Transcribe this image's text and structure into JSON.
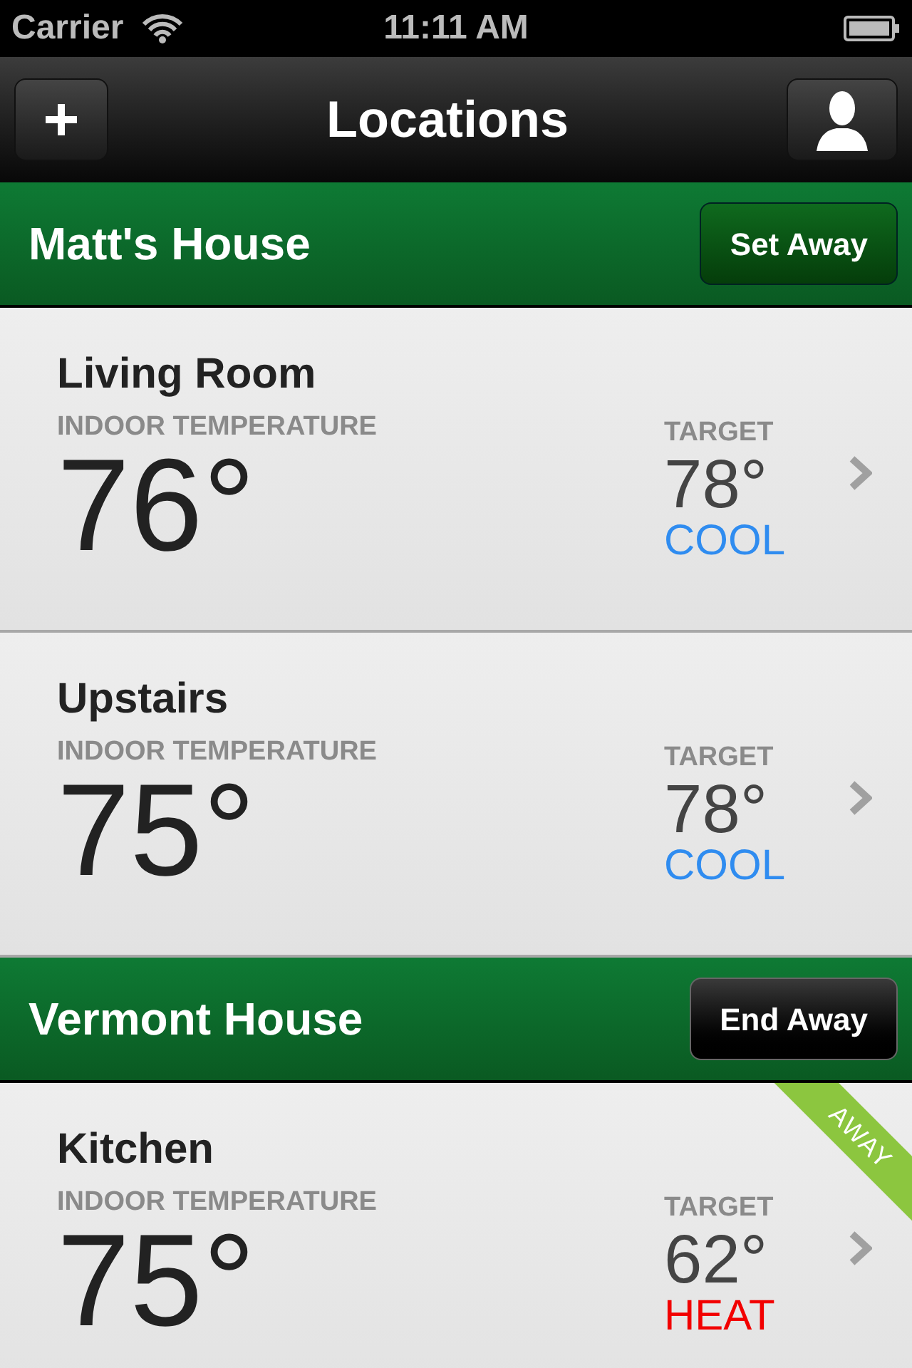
{
  "status_bar": {
    "carrier": "Carrier",
    "time": "11:11 AM"
  },
  "nav": {
    "title": "Locations"
  },
  "groups": [
    {
      "name": "Matt's House",
      "away": false,
      "button": "Set Away",
      "rooms": [
        {
          "name": "Living Room",
          "indoor_label": "INDOOR TEMPERATURE",
          "indoor": "76°",
          "target_label": "TARGET",
          "target": "78°",
          "mode": "COOL",
          "kind": "cool"
        },
        {
          "name": "Upstairs",
          "indoor_label": "INDOOR TEMPERATURE",
          "indoor": "75°",
          "target_label": "TARGET",
          "target": "78°",
          "mode": "COOL",
          "kind": "cool"
        }
      ]
    },
    {
      "name": "Vermont House",
      "away": true,
      "button": "End Away",
      "rooms": [
        {
          "name": "Kitchen",
          "indoor_label": "INDOOR TEMPERATURE",
          "indoor": "75°",
          "target_label": "TARGET",
          "target": "62°",
          "mode": "HEAT",
          "kind": "heat",
          "ribbon": "AWAY"
        }
      ]
    }
  ]
}
